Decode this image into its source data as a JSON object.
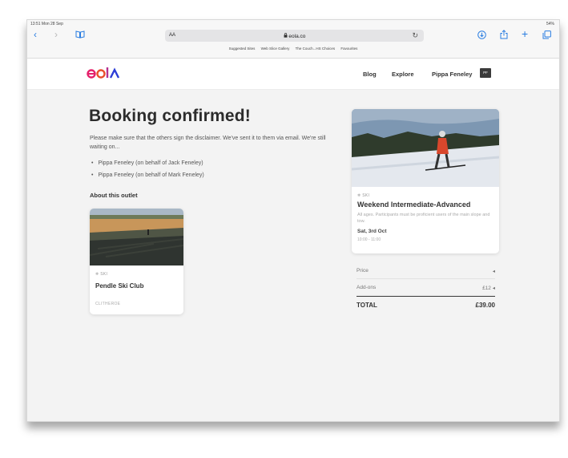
{
  "status_bar": {
    "time": "13:51  Mon 28 Sep",
    "battery": "54%"
  },
  "browser": {
    "text_size_label": "AA",
    "url": "eola.co",
    "favourites": [
      "Suggested Sites",
      "Web Slice Gallery",
      "The Couch...HS Choices",
      "Favourites"
    ]
  },
  "header": {
    "logo": "eola",
    "nav": [
      "Blog",
      "Explore",
      "Pippa Feneley"
    ],
    "avatar_initials": "PF"
  },
  "main": {
    "title": "Booking confirmed!",
    "message": "Please make sure that the others sign the disclaimer. We've sent it to them via email. We're still waiting on...",
    "pending": [
      "Pippa Feneley (on behalf of Jack Feneley)",
      "Pippa Feneley (on behalf of Mark Feneley)"
    ],
    "about_heading": "About this outlet",
    "outlet": {
      "tag": "SKI",
      "name": "Pendle Ski Club",
      "location": "CLITHEROE"
    }
  },
  "activity": {
    "tag": "SKI",
    "name": "Weekend Intermediate-Advanced",
    "description": "All ages. Participants must be proficient users of the main slope and tow.",
    "date": "Sat, 3rd Oct",
    "time": "10:00 - 11:00"
  },
  "pricing": {
    "price_label": "Price",
    "price_value": "◂",
    "addons_label": "Add-ons",
    "addons_value": "£12 ◂",
    "total_label": "TOTAL",
    "total_value": "£39.00"
  },
  "colors": {
    "accent": "#2a7de1",
    "logo_red": "#e5206b",
    "logo_blue": "#2d3ed6"
  }
}
